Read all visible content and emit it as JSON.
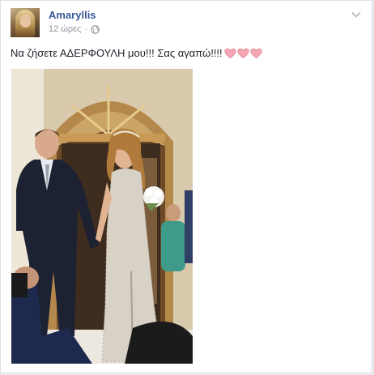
{
  "post": {
    "author_name": "Amaryllis",
    "timestamp": "12 ώρες",
    "separator": "·",
    "privacy_icon": "globe-icon",
    "menu_icon": "chevron-down-icon",
    "text": "Να ζήσετε ΑΔΕΡΦΟΥΛΗ μου!!! Σας αγαπώ!!!!",
    "hearts": [
      "heart-icon",
      "heart-icon",
      "heart-icon"
    ],
    "heart_color": "#f4a7b3"
  },
  "theme": {
    "link_color": "#3b5998",
    "meta_color": "#90949c",
    "text_color": "#1d2129"
  }
}
